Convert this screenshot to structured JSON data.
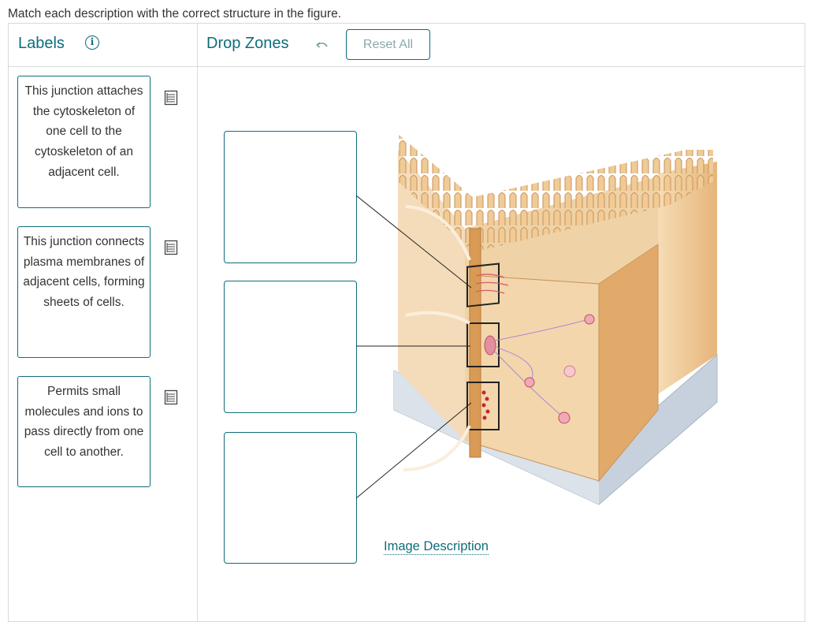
{
  "instruction": "Match each description with the correct structure in the figure.",
  "labels_panel": {
    "title": "Labels",
    "info_icon": "info-icon",
    "cards": [
      {
        "text": "This junction attaches the cytoskeleton of one cell to the cytoskeleton of an adjacent cell.",
        "icon": "notes-icon"
      },
      {
        "text": "This junction connects plasma membranes of adjacent cells, forming sheets of cells.",
        "icon": "notes-icon"
      },
      {
        "text": "Permits small molecules and ions to pass directly from one cell to another.",
        "icon": "notes-icon"
      }
    ]
  },
  "drop_panel": {
    "title": "Drop Zones",
    "undo_icon": "undo-arrow-icon",
    "reset_label": "Reset All",
    "zones": [
      {
        "content": ""
      },
      {
        "content": ""
      },
      {
        "content": ""
      }
    ],
    "image_description_link": "Image Description"
  },
  "colors": {
    "accent": "#0e6d7c",
    "border": "#d9d9d9",
    "cell_tan": "#e8b87a",
    "basement": "#c9d3de"
  }
}
